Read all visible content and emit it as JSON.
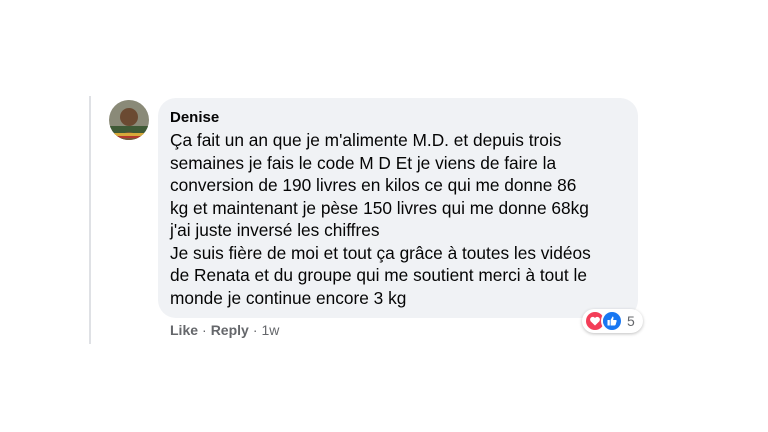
{
  "comment": {
    "author": "Denise",
    "lines": [
      "Ça fait un an que je m'alimente M.D. et depuis trois",
      "semaines je fais le code M D Et je viens de faire la",
      "conversion de 190 livres en kilos ce qui me donne 86",
      "kg et maintenant je pèse 150 livres qui me donne 68kg",
      "j'ai juste inversé les chiffres",
      "Je suis fière de moi et tout ça grâce à toutes les vidéos",
      "de Renata et du groupe qui me soutient merci à tout le",
      "monde je continue encore 3 kg"
    ]
  },
  "actions": {
    "like": "Like",
    "reply": "Reply",
    "separator": "·",
    "time": "1w"
  },
  "reactions": {
    "icons": [
      "heart-reaction-icon",
      "like-reaction-icon"
    ],
    "count": "5",
    "colors": {
      "heart": "#f33e58",
      "like": "#1877f2"
    }
  }
}
